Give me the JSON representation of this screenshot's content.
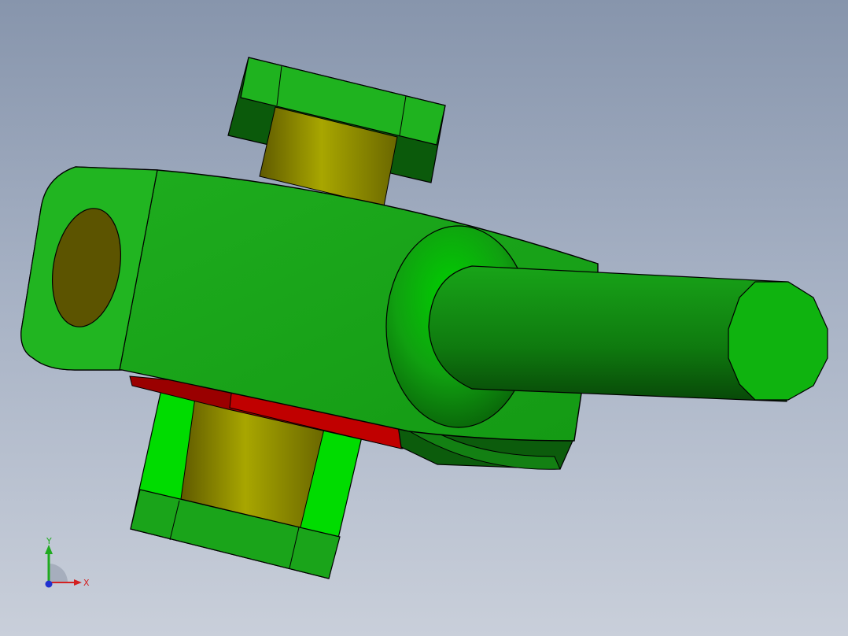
{
  "viewport": {
    "background_top": "#8795ac",
    "background_bottom": "#c9cfda"
  },
  "model": {
    "parts": [
      "body",
      "shaft",
      "bushing-top",
      "bushing-bottom",
      "bearing-sleeve",
      "washer"
    ],
    "colors": {
      "body": "#1fb31f",
      "body_dark": "#0f6d0f",
      "bright": "#00e000",
      "sleeve": "#9c9a00",
      "sleeve_dark": "#5f5a00",
      "washer": "#b30000"
    }
  },
  "triad": {
    "x_label": "X",
    "y_label": "Y",
    "x_color": "#d32020",
    "y_color": "#1faa1f",
    "z_color": "#2030d0"
  }
}
